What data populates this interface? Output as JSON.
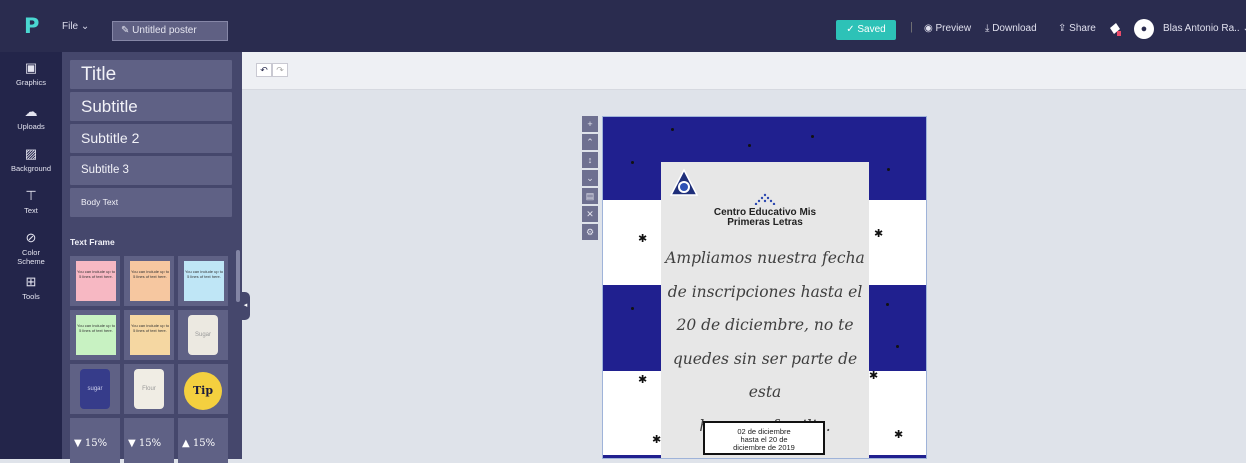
{
  "topbar": {
    "file_label": "File ⌄",
    "doc_title": "Untitled poster",
    "saved_label": "✓  Saved",
    "separator": "|",
    "preview_label": "Preview",
    "download_label": "Download",
    "share_label": "Share",
    "user_name": "Blas Antonio Ra.. ⌄"
  },
  "rail": {
    "items": [
      {
        "label": "Graphics",
        "icon": "image-icon"
      },
      {
        "label": "Uploads",
        "icon": "cloud-upload-icon"
      },
      {
        "label": "Background",
        "icon": "pattern-icon"
      },
      {
        "label": "Text",
        "icon": "text-icon"
      },
      {
        "label": "Color Scheme",
        "icon": "palette-icon"
      },
      {
        "label": "Tools",
        "icon": "toolbox-icon"
      }
    ]
  },
  "panel": {
    "styles": [
      "Title",
      "Subtitle",
      "Subtitle 2",
      "Subtitle 3",
      "Body Text"
    ],
    "text_frame_label": "Text Frame",
    "note_text": "You can include up to 5 lines of text here.",
    "sugar_label": "Sugar",
    "sugar_dark_label": "sugar",
    "flour_label": "Flour",
    "tip_label": "Tip",
    "pct_label": "15%"
  },
  "poster": {
    "school_name_line1": "Centro Educativo Mis",
    "school_name_line2": "Primeras Letras",
    "script_lines": [
      "Ampliamos nuestra fecha",
      "de inscripciones hasta el",
      "20 de diciembre, no te",
      "quedes sin ser parte de esta",
      "hermosa familia."
    ],
    "date_lines": [
      "02 de diciembre",
      "hasta el 20 de",
      "diciembre de 2019"
    ]
  },
  "colors": {
    "topbar": "#2a2c4f",
    "accent": "#2dc2b7",
    "flag_blue": "#20208f",
    "panel": "#45476c"
  }
}
